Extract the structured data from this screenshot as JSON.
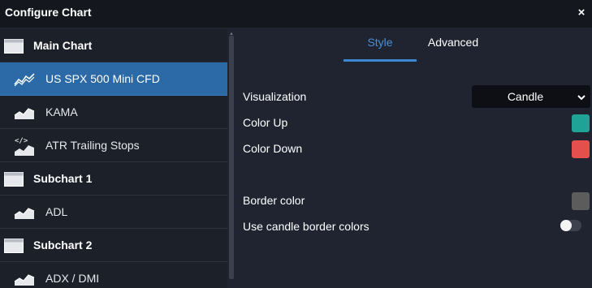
{
  "dialog": {
    "title": "Configure Chart",
    "close_label": "×"
  },
  "sidebar": {
    "items": [
      {
        "label": "Main Chart",
        "icon": "window-icon",
        "kind": "group"
      },
      {
        "label": "US SPX 500 Mini CFD",
        "icon": "line-chart-icon",
        "kind": "series",
        "selected": true
      },
      {
        "label": "KAMA",
        "icon": "area-chart-icon",
        "kind": "indicator"
      },
      {
        "label": "ATR Trailing Stops",
        "icon": "script-chart-icon",
        "kind": "indicator"
      },
      {
        "label": "Subchart 1",
        "icon": "window-icon",
        "kind": "group"
      },
      {
        "label": "ADL",
        "icon": "area-chart-icon",
        "kind": "indicator"
      },
      {
        "label": "Subchart 2",
        "icon": "window-icon",
        "kind": "group"
      },
      {
        "label": "ADX / DMI",
        "icon": "area-chart-icon",
        "kind": "indicator"
      }
    ]
  },
  "tabs": [
    {
      "label": "Style",
      "active": true
    },
    {
      "label": "Advanced",
      "active": false
    }
  ],
  "style": {
    "visualization": {
      "label": "Visualization",
      "value": "Candle"
    },
    "color_up": {
      "label": "Color Up",
      "color": "#1fa396"
    },
    "color_down": {
      "label": "Color Down",
      "color": "#e5504f"
    },
    "border_color": {
      "label": "Border color",
      "color": "#5c5c5c"
    },
    "use_candle_border_colors": {
      "label": "Use candle border colors",
      "enabled": false
    }
  },
  "colors": {
    "accent": "#3e86d0",
    "selected_row": "#2b6aa6",
    "background": "#1f2430"
  }
}
